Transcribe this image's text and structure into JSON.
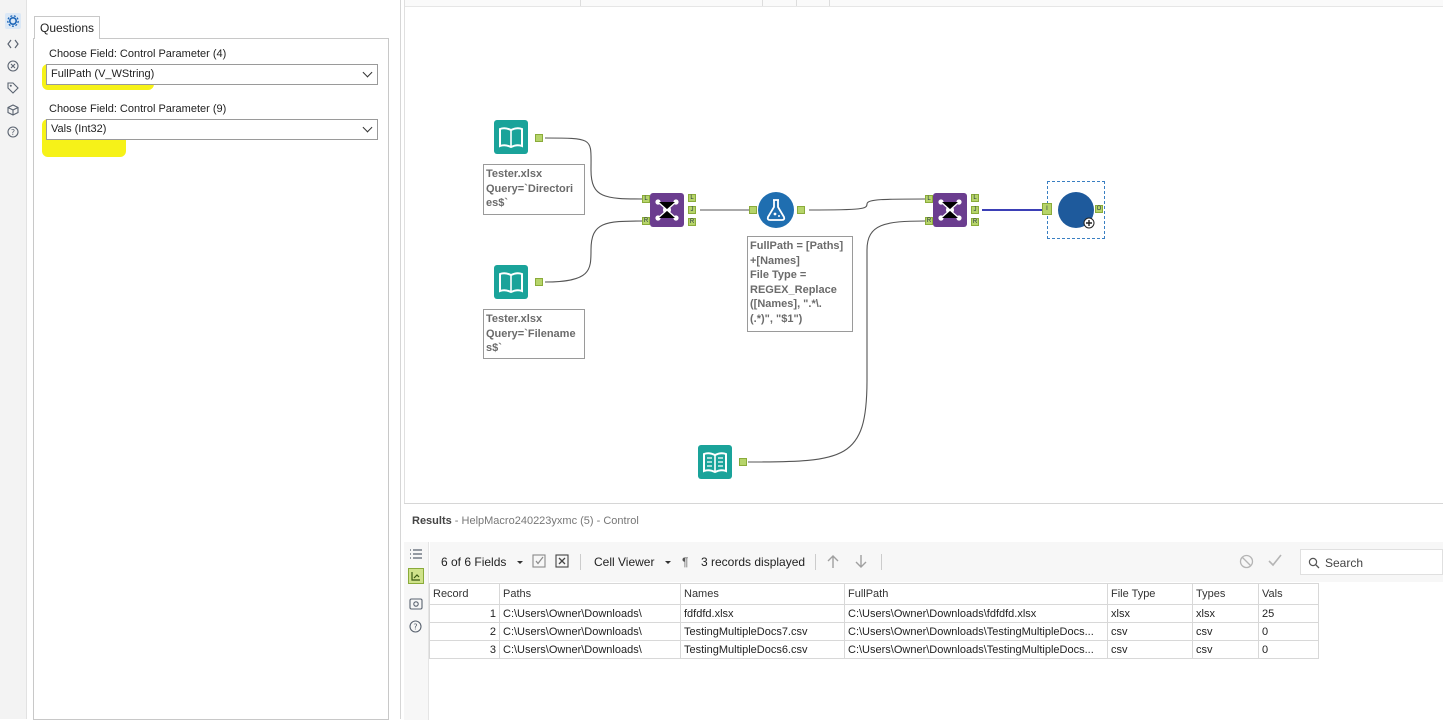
{
  "config": {
    "tab_label": "Questions",
    "field1": {
      "label": "Choose Field: Control Parameter (4)",
      "value": "FullPath (V_WString)"
    },
    "field2": {
      "label": "Choose Field: Control Parameter (9)",
      "value": "Vals (Int32)"
    }
  },
  "rail_icons": [
    "gear-icon",
    "code-icon",
    "connection-icon",
    "tag-icon",
    "cube-icon",
    "help-icon"
  ],
  "canvas": {
    "input1_annotation": "Tester.xlsx\nQuery=`Directori\nes$`",
    "input2_annotation": "Tester.xlsx\nQuery=`Filename\ns$`",
    "formula_annotation": "FullPath = [Paths]\n+[Names]\nFile Type =\nREGEX_Replace\n([Names], \".*\\.\n(.*)\", \"$1\")",
    "anchors": {
      "left": "L",
      "join": "J",
      "right": "R",
      "input": "I",
      "output": "O"
    }
  },
  "results": {
    "title_bold": "Results",
    "title_rest": " - HelpMacro240223yxmc (5) - Control",
    "fields_label": "6 of 6 Fields",
    "viewer_label": "Cell Viewer",
    "pilcrow": "¶",
    "records_label": "3 records displayed",
    "search_placeholder": "Search",
    "columns": [
      "Record",
      "Paths",
      "Names",
      "FullPath",
      "File Type",
      "Types",
      "Vals"
    ],
    "rows": [
      [
        "1",
        "C:\\Users\\Owner\\Downloads\\",
        "fdfdfd.xlsx",
        "C:\\Users\\Owner\\Downloads\\fdfdfd.xlsx",
        "xlsx",
        "xlsx",
        "25"
      ],
      [
        "2",
        "C:\\Users\\Owner\\Downloads\\",
        "TestingMultipleDocs7.csv",
        "C:\\Users\\Owner\\Downloads\\TestingMultipleDocs...",
        "csv",
        "csv",
        "0"
      ],
      [
        "3",
        "C:\\Users\\Owner\\Downloads\\",
        "TestingMultipleDocs6.csv",
        "C:\\Users\\Owner\\Downloads\\TestingMultipleDocs...",
        "csv",
        "csv",
        "0"
      ]
    ]
  },
  "colors": {
    "accent": "#1d66b8",
    "input_tool": "#1aa39a",
    "join_tool": "#6b3d8f",
    "formula_tool": "#1f6eb0",
    "macro_out": "#1e5a9c",
    "highlight": "#f6f218"
  }
}
